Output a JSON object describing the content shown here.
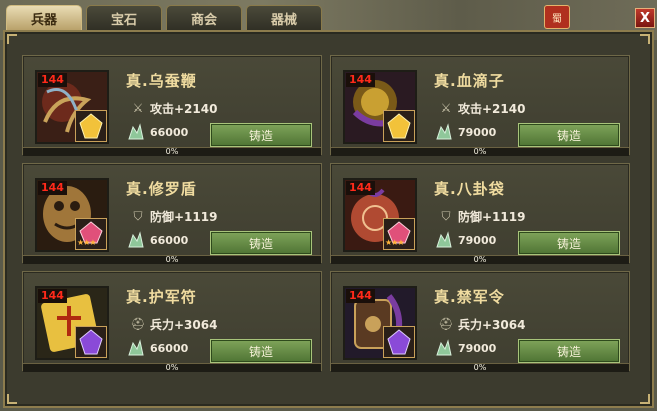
{
  "tabs": [
    {
      "label": "兵器",
      "active": true
    },
    {
      "label": "宝石",
      "active": false
    },
    {
      "label": "商会",
      "active": false
    },
    {
      "label": "器械",
      "active": false
    }
  ],
  "seal_text": "蜀",
  "close_label": "X",
  "accent_colors": {
    "button": "#6f8f4a",
    "level": "#ff2a1a",
    "title": "#f0dca0"
  },
  "items": [
    {
      "level": "144",
      "name": "真.乌蚕鞭",
      "stat_icon": "sword-icon",
      "stat": "攻击+2140",
      "cost": "66000",
      "forge_label": "铸造",
      "progress_text": "0%",
      "progress": 0,
      "gem": "gold"
    },
    {
      "level": "144",
      "name": "真.血滴子",
      "stat_icon": "sword-icon",
      "stat": "攻击+2140",
      "cost": "79000",
      "forge_label": "铸造",
      "progress_text": "0%",
      "progress": 0,
      "gem": "gold"
    },
    {
      "level": "144",
      "name": "真.修罗盾",
      "stat_icon": "shield-icon",
      "stat": "防御+1119",
      "cost": "66000",
      "forge_label": "铸造",
      "progress_text": "0%",
      "progress": 0,
      "gem": "red"
    },
    {
      "level": "144",
      "name": "真.八卦袋",
      "stat_icon": "shield-icon",
      "stat": "防御+1119",
      "cost": "79000",
      "forge_label": "铸造",
      "progress_text": "0%",
      "progress": 0,
      "gem": "red"
    },
    {
      "level": "144",
      "name": "真.护军符",
      "stat_icon": "helmet-icon",
      "stat": "兵力+3064",
      "cost": "66000",
      "forge_label": "铸造",
      "progress_text": "0%",
      "progress": 0,
      "gem": "purple"
    },
    {
      "level": "144",
      "name": "真.禁军令",
      "stat_icon": "helmet-icon",
      "stat": "兵力+3064",
      "cost": "79000",
      "forge_label": "铸造",
      "progress_text": "0%",
      "progress": 0,
      "gem": "purple"
    }
  ]
}
